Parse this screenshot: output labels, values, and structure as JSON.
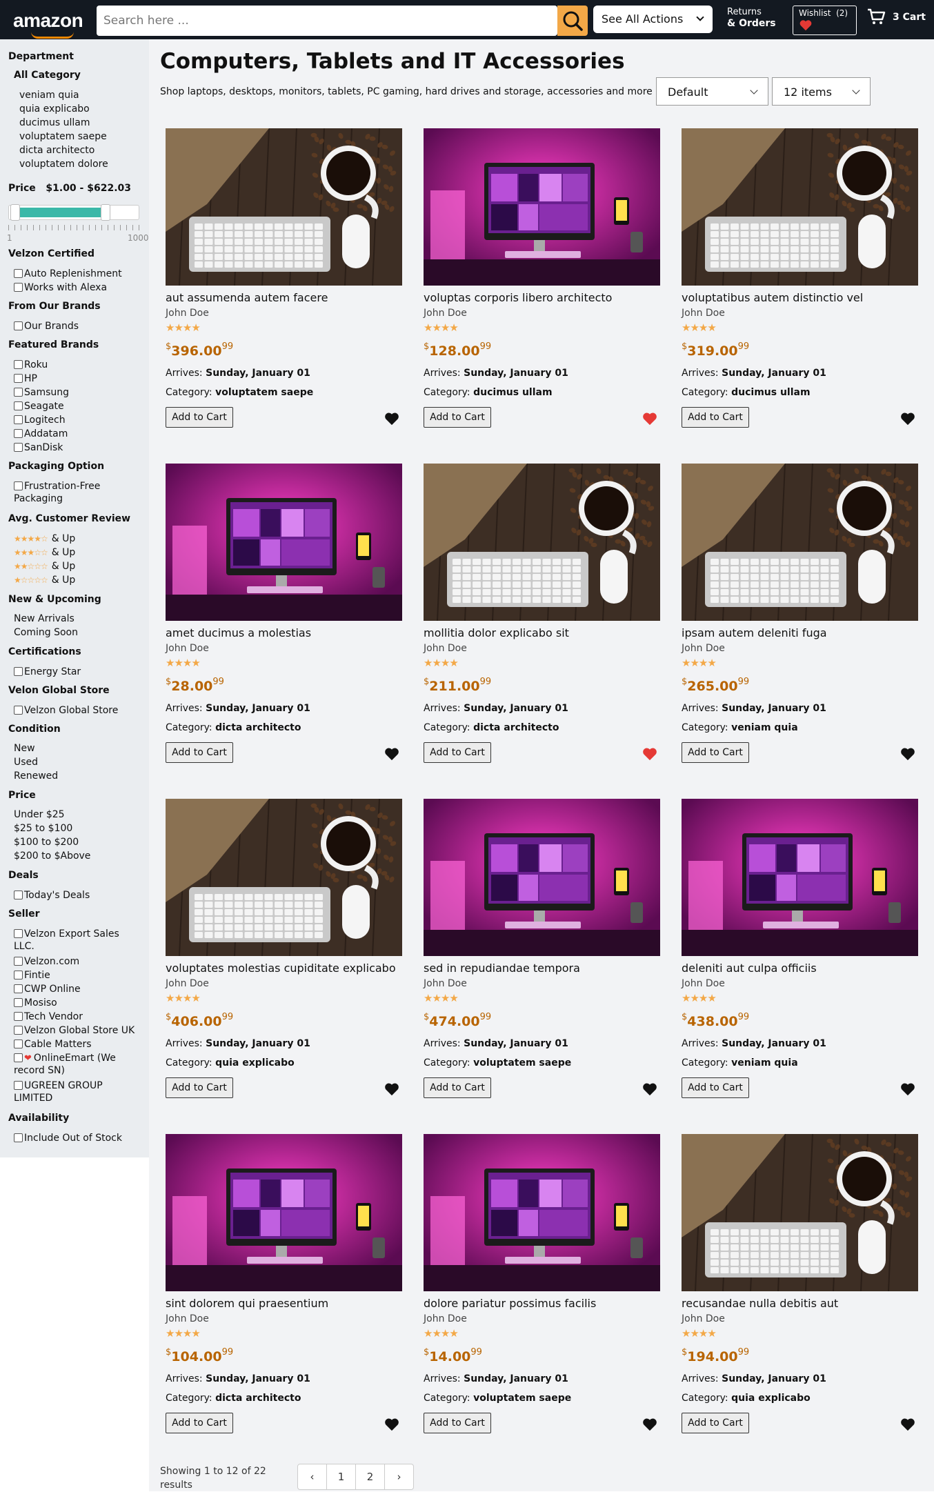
{
  "header": {
    "logo": "amazon",
    "search_placeholder": "Search here ...",
    "actions_label": "See All Actions",
    "returns_line1": "Returns",
    "returns_line2": "& Orders",
    "wishlist_label": "Wishlist",
    "wishlist_count": "(2)",
    "cart_label": "3 Cart"
  },
  "sidebar": {
    "department": "Department",
    "all_category": "All Category",
    "categories": [
      "veniam quia",
      "quia explicabo",
      "ducimus ullam",
      "voluptatem saepe",
      "dicta architecto",
      "voluptatem dolore"
    ],
    "price_label": "Price",
    "price_range": "$1.00 - $622.03",
    "slider_min_label": "1",
    "slider_max_label": "1000",
    "slider_fill_fraction": 0.622,
    "certified": "Velzon Certified",
    "certified_items": [
      "Auto Replenishment",
      "Works with Alexa"
    ],
    "from_brands": "From Our Brands",
    "from_brands_items": [
      "Our Brands"
    ],
    "featured_brands": "Featured Brands",
    "featured_items": [
      "Roku",
      "HP",
      "Samsung",
      "Seagate",
      "Logitech",
      "Addatam",
      "SanDisk"
    ],
    "packaging": "Packaging Option",
    "packaging_items": [
      "Frustration-Free",
      "Packaging"
    ],
    "review": "Avg. Customer Review",
    "review_items": [
      {
        "stars": 4,
        "label": "& Up"
      },
      {
        "stars": 3,
        "label": "& Up"
      },
      {
        "stars": 2,
        "label": "& Up"
      },
      {
        "stars": 1,
        "label": "& Up"
      }
    ],
    "upcoming": "New & Upcoming",
    "upcoming_items": [
      "New Arrivals",
      "Coming Soon"
    ],
    "certifications": "Certifications",
    "certifications_items": [
      "Energy Star"
    ],
    "global_store": "Velon Global Store",
    "global_store_items": [
      "Velzon Global Store"
    ],
    "condition": "Condition",
    "condition_items": [
      "New",
      "Used",
      "Renewed"
    ],
    "price2": "Price",
    "price2_items": [
      "Under $25",
      "$25 to $100",
      "$100 to $200",
      "$200 to $Above"
    ],
    "deals": "Deals",
    "deals_items": [
      "Today's Deals"
    ],
    "seller": "Seller",
    "seller_items": [
      "Velzon Export Sales",
      "LLC.",
      "Velzon.com",
      "Fintie",
      "CWP Online",
      "Mosiso",
      "Tech Vendor",
      "Velzon Global Store UK",
      "Cable Matters",
      "OnlineEmart (We",
      "record SN)",
      "UGREEN GROUP",
      "LIMITED"
    ],
    "availability": "Availability",
    "availability_items": [
      "Include Out of Stock"
    ]
  },
  "main": {
    "title": "Computers, Tablets and IT Accessories",
    "subtitle": "Shop laptops, desktops, monitors, tablets, PC gaming, hard drives and storage, accessories and more",
    "sort_value": "Default",
    "perpage_value": "12 items",
    "arrives_label": "Arrives:",
    "arrives_date": "Sunday, January 01",
    "category_label": "Category:",
    "add_label": "Add to Cart",
    "products": [
      {
        "name": "aut assumenda autem facere",
        "author": "John Doe",
        "rating": 4,
        "price": "396.00",
        "cents": "99",
        "category": "voluptatem saepe",
        "img": "keyboard",
        "liked": false
      },
      {
        "name": "voluptas corporis libero architecto",
        "author": "John Doe",
        "rating": 4,
        "price": "128.00",
        "cents": "99",
        "category": "ducimus ullam",
        "img": "monitor",
        "liked": true
      },
      {
        "name": "voluptatibus autem distinctio vel",
        "author": "John Doe",
        "rating": 4,
        "price": "319.00",
        "cents": "99",
        "category": "ducimus ullam",
        "img": "keyboard",
        "liked": false
      },
      {
        "name": "amet ducimus a molestias",
        "author": "John Doe",
        "rating": 4,
        "price": "28.00",
        "cents": "99",
        "category": "dicta architecto",
        "img": "monitor",
        "liked": false
      },
      {
        "name": "mollitia dolor explicabo sit",
        "author": "John Doe",
        "rating": 4,
        "price": "211.00",
        "cents": "99",
        "category": "dicta architecto",
        "img": "keyboard",
        "liked": true
      },
      {
        "name": "ipsam autem deleniti fuga",
        "author": "John Doe",
        "rating": 4,
        "price": "265.00",
        "cents": "99",
        "category": "veniam quia",
        "img": "keyboard",
        "liked": false
      },
      {
        "name": "voluptates molestias cupiditate explicabo",
        "author": "John Doe",
        "rating": 4,
        "price": "406.00",
        "cents": "99",
        "category": "quia explicabo",
        "img": "keyboard",
        "liked": false
      },
      {
        "name": "sed in repudiandae tempora",
        "author": "John Doe",
        "rating": 4,
        "price": "474.00",
        "cents": "99",
        "category": "voluptatem saepe",
        "img": "monitor",
        "liked": false
      },
      {
        "name": "deleniti aut culpa officiis",
        "author": "John Doe",
        "rating": 4,
        "price": "438.00",
        "cents": "99",
        "category": "veniam quia",
        "img": "monitor",
        "liked": false
      },
      {
        "name": "sint dolorem qui praesentium",
        "author": "John Doe",
        "rating": 4,
        "price": "104.00",
        "cents": "99",
        "category": "dicta architecto",
        "img": "monitor",
        "liked": false
      },
      {
        "name": "dolore pariatur possimus facilis",
        "author": "John Doe",
        "rating": 4,
        "price": "14.00",
        "cents": "99",
        "category": "voluptatem saepe",
        "img": "monitor",
        "liked": false
      },
      {
        "name": "recusandae nulla debitis aut",
        "author": "John Doe",
        "rating": 4,
        "price": "194.00",
        "cents": "99",
        "category": "quia explicabo",
        "img": "keyboard",
        "liked": false
      }
    ]
  },
  "pagination": {
    "summary_line1": "Showing 1 to 12 of 22",
    "summary_line2": "results",
    "prev": "‹",
    "pages": [
      "1",
      "2"
    ],
    "next": "›"
  },
  "colors": {
    "heart_liked": "#e53935",
    "heart_default": "#111111",
    "price": "#b86400",
    "star": "#f3a847"
  }
}
